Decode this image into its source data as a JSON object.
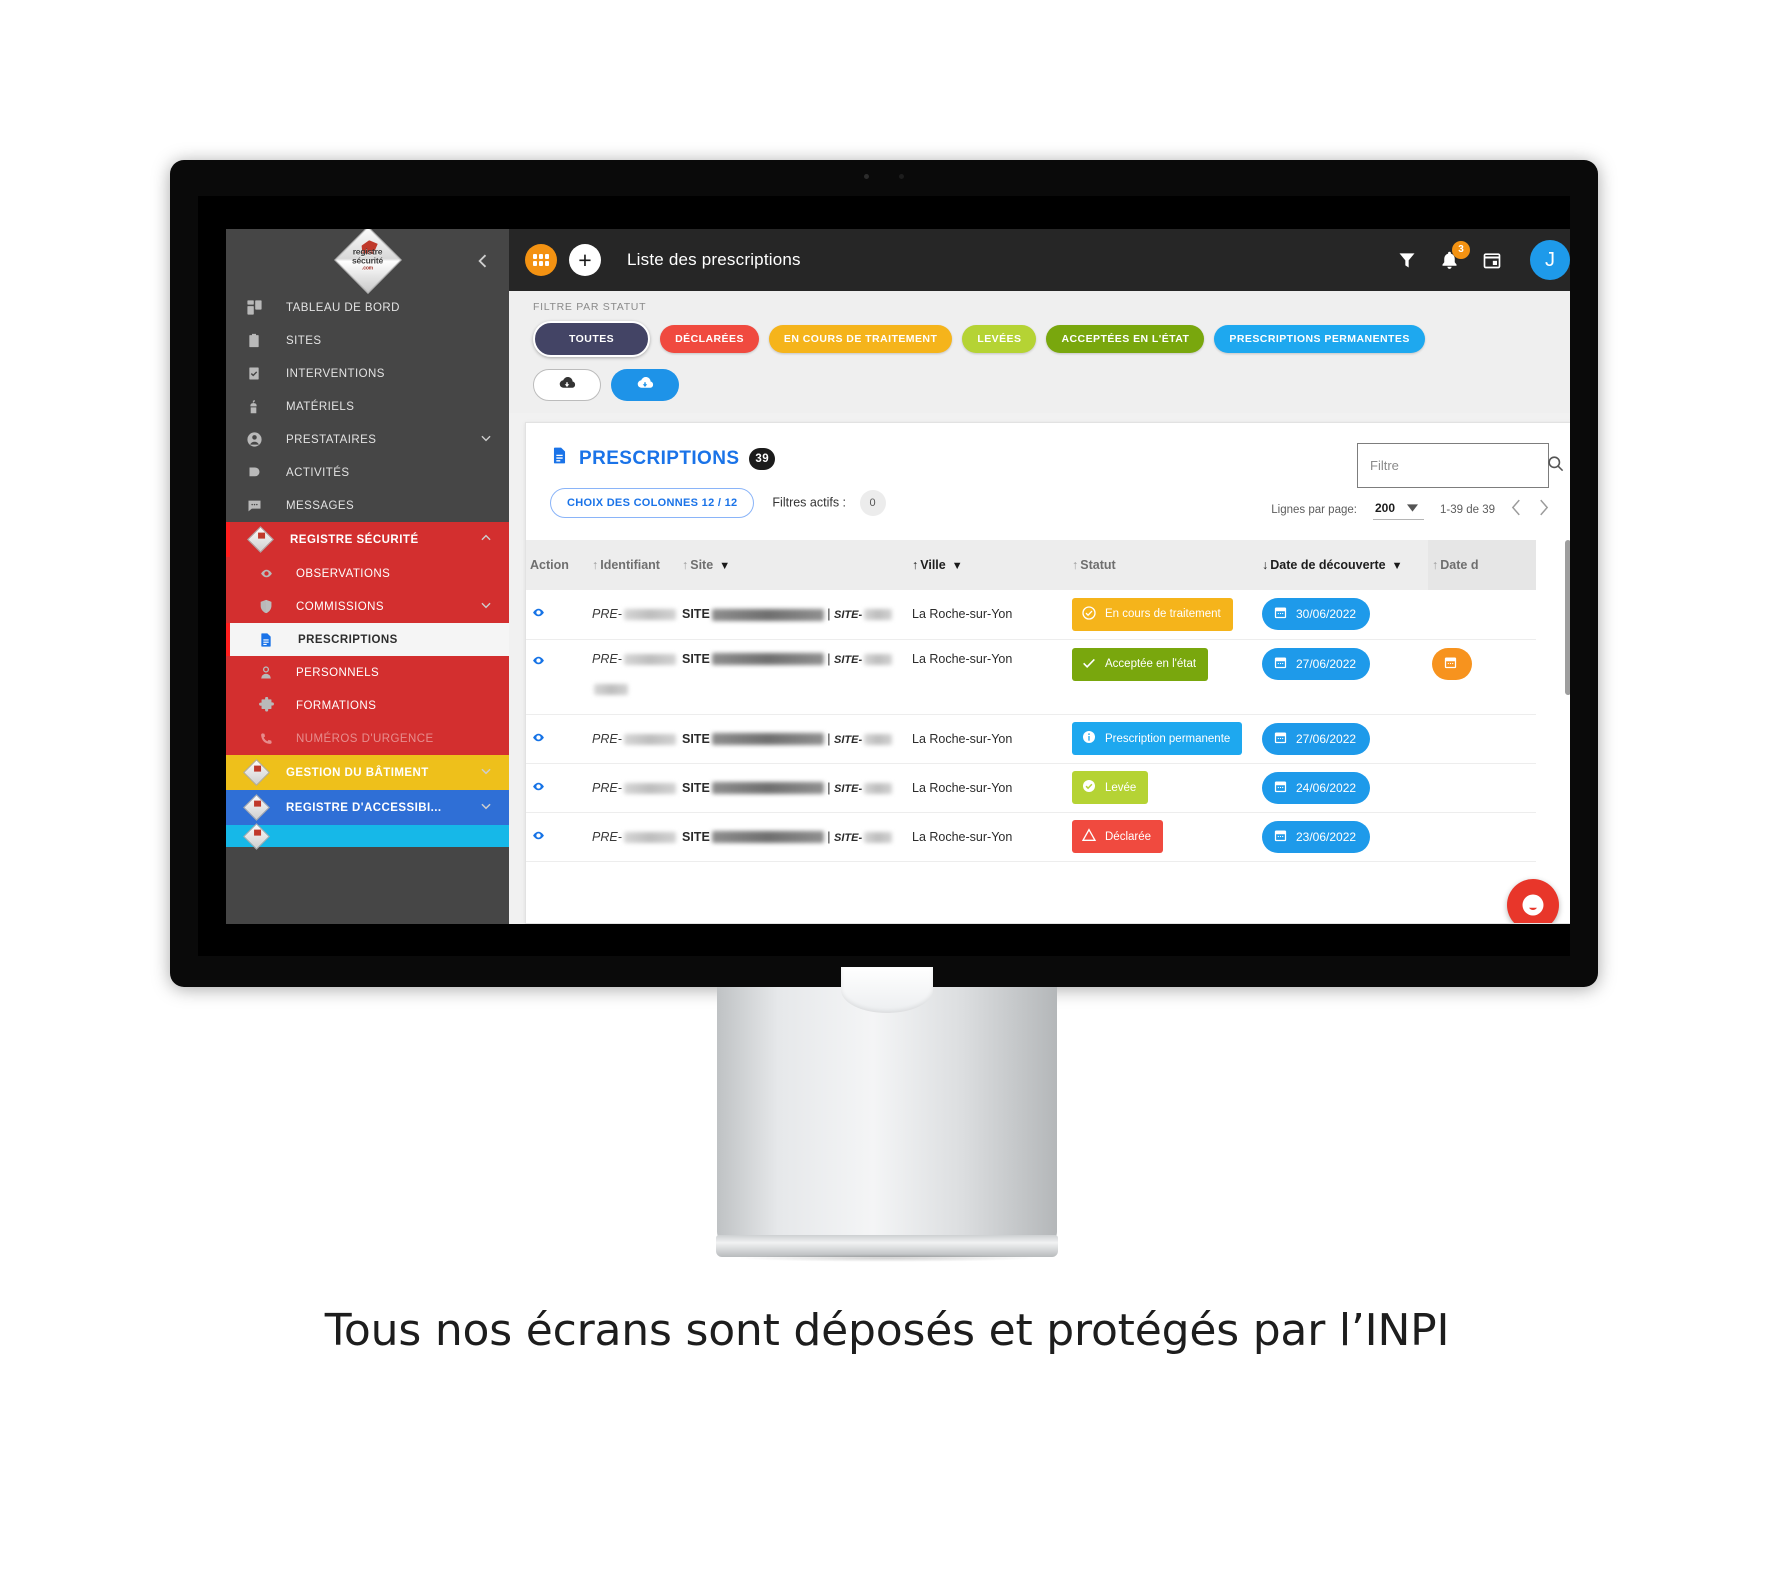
{
  "caption": "Tous nos écrans sont déposés et protégés par l’INPI",
  "sidebar": {
    "logo": {
      "line1": "registre",
      "line2": "sécurité",
      "line3": ".com"
    },
    "collapse_icon": "chevron-left-icon",
    "items": [
      {
        "label": "TABLEAU DE BORD",
        "icon": "dashboard-icon",
        "chevron": ""
      },
      {
        "label": "SITES",
        "icon": "clipboard-icon",
        "chevron": ""
      },
      {
        "label": "INTERVENTIONS",
        "icon": "clipboard-check-icon",
        "chevron": ""
      },
      {
        "label": "MATÉRIELS",
        "icon": "extinguisher-icon",
        "chevron": ""
      },
      {
        "label": "PRESTATAIRES",
        "icon": "person-circle-icon",
        "chevron": "chevron-down-icon"
      },
      {
        "label": "ACTIVITÉS",
        "icon": "flag-icon",
        "chevron": ""
      },
      {
        "label": "MESSAGES",
        "icon": "chat-icon",
        "chevron": ""
      }
    ],
    "registre_securite": {
      "label": "REGISTRE SÉCURITÉ",
      "icon": "diamond-logo-icon",
      "chevron": "chevron-up-icon",
      "sub_items": [
        {
          "label": "OBSERVATIONS",
          "icon": "eye-icon",
          "chevron": ""
        },
        {
          "label": "COMMISSIONS",
          "icon": "shield-icon",
          "chevron": "chevron-down-icon"
        },
        {
          "label": "PRESCRIPTIONS",
          "icon": "document-icon",
          "chevron": "",
          "active": true
        },
        {
          "label": "PERSONNELS",
          "icon": "user-icon",
          "chevron": ""
        },
        {
          "label": "FORMATIONS",
          "icon": "puzzle-icon",
          "chevron": ""
        },
        {
          "label": "NUMÉROS D'URGENCE",
          "icon": "phone-icon",
          "chevron": "",
          "dimmed": true
        }
      ]
    },
    "sections": [
      {
        "label": "GESTION DU BÂTIMENT",
        "icon": "diamond-logo-icon",
        "chevron": "chevron-down-icon",
        "color": "#eec01b"
      },
      {
        "label": "REGISTRE D'ACCESSIBI...",
        "icon": "diamond-logo-icon",
        "chevron": "chevron-down-icon",
        "color": "#2f6fd6"
      }
    ]
  },
  "topbar": {
    "grid_icon": "apps-grid-icon",
    "add_icon": "plus-icon",
    "title": "Liste des prescriptions",
    "filter_icon": "funnel-icon",
    "bell_icon": "bell-icon",
    "bell_count": "3",
    "calendar_icon": "calendar-icon",
    "avatar_initial": "J"
  },
  "status_filter": {
    "label": "FILTRE PAR STATUT",
    "chips": [
      {
        "label": "TOUTES",
        "color": "#434465",
        "selected": true
      },
      {
        "label": "DÉCLARÉES",
        "color": "#f04a3f"
      },
      {
        "label": "EN COURS DE TRAITEMENT",
        "color": "#f5b41b"
      },
      {
        "label": "LEVÉES",
        "color": "#b5d334"
      },
      {
        "label": "ACCEPTÉES EN L'ÉTAT",
        "color": "#79a70d"
      },
      {
        "label": "PRESCRIPTIONS PERMANENTES",
        "color": "#1ea8ef"
      }
    ],
    "download_buttons": [
      {
        "icon": "cloud-download-icon",
        "style": "outline"
      },
      {
        "icon": "cloud-download-icon",
        "style": "filled"
      }
    ]
  },
  "card": {
    "title": "PRESCRIPTIONS",
    "title_icon": "document-icon",
    "count": "39",
    "columns_button": "CHOIX DES COLONNES 12 / 12",
    "active_filters_label": "Filtres actifs :",
    "active_filters_count": "0",
    "search": {
      "placeholder": "Filtre",
      "value": "",
      "icon": "search-icon"
    },
    "pager": {
      "rows_label": "Lignes par page:",
      "rows_value": "200",
      "range": "1-39 de 39",
      "prev_icon": "chevron-left-icon",
      "next_icon": "chevron-right-icon"
    }
  },
  "table": {
    "columns": [
      {
        "label": "Action",
        "sort": "",
        "filter": false
      },
      {
        "label": "Identifiant",
        "sort": "↑",
        "filter": false
      },
      {
        "label": "Site",
        "sort": "↑",
        "filter": true
      },
      {
        "label": "Ville",
        "sort": "↑",
        "filter": true
      },
      {
        "label": "Statut",
        "sort": "↑",
        "filter": false
      },
      {
        "label": "Date de découverte",
        "sort": "↓",
        "filter": true,
        "sorted": true
      },
      {
        "label": "Date d",
        "sort": "↑",
        "filter": false
      }
    ],
    "rows": [
      {
        "action_icon": "eye-icon",
        "identifiant_prefix": "PRE-",
        "site_prefix": "SITE",
        "site_suffix": "SITE-",
        "ville": "La Roche-sur-Yon",
        "statut": {
          "label": "En cours de traitement",
          "style": "encours",
          "icon": "check-circle-outline-icon"
        },
        "date_decouverte": "30/06/2022",
        "date_2": ""
      },
      {
        "action_icon": "eye-icon",
        "identifiant_prefix": "PRE-",
        "site_prefix": "SITE",
        "site_suffix": "SITE-",
        "ville": "La Roche-sur-Yon",
        "statut": {
          "label": "Acceptée en l'état",
          "style": "acceptee",
          "icon": "check-icon"
        },
        "date_decouverte": "27/06/2022",
        "date_2": "orange-pill",
        "tall": true
      },
      {
        "action_icon": "eye-icon",
        "identifiant_prefix": "PRE-",
        "site_prefix": "SITE",
        "site_suffix": "SITE-",
        "ville": "La Roche-sur-Yon",
        "statut": {
          "label": "Prescription permanente",
          "style": "perm",
          "icon": "info-icon"
        },
        "date_decouverte": "27/06/2022",
        "date_2": ""
      },
      {
        "action_icon": "eye-icon",
        "identifiant_prefix": "PRE-",
        "site_prefix": "SITE",
        "site_suffix": "SITE-",
        "ville": "La Roche-sur-Yon",
        "statut": {
          "label": "Levée",
          "style": "levee",
          "icon": "check-circle-icon"
        },
        "date_decouverte": "24/06/2022",
        "date_2": ""
      },
      {
        "action_icon": "eye-icon",
        "identifiant_prefix": "PRE-",
        "site_prefix": "SITE",
        "site_suffix": "SITE-",
        "ville": "La Roche-sur-Yon",
        "statut": {
          "label": "Déclarée",
          "style": "declaree",
          "icon": "warning-triangle-icon"
        },
        "date_decouverte": "23/06/2022",
        "date_2": ""
      }
    ]
  },
  "chat_widget": {
    "icon": "chat-support-icon",
    "color": "#e8362a"
  }
}
